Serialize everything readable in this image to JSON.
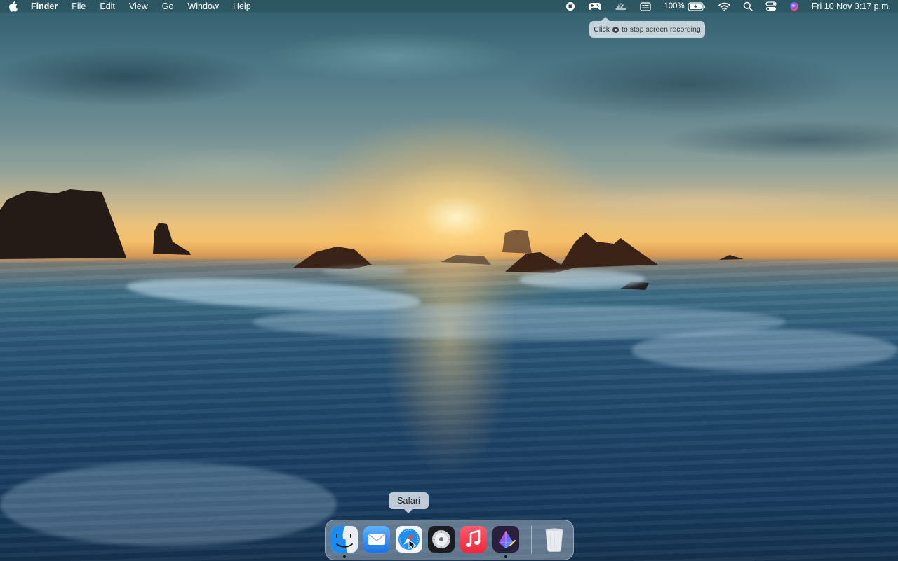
{
  "menubar": {
    "apple_menu": "apple-menu",
    "app_name": "Finder",
    "menus": [
      "File",
      "Edit",
      "View",
      "Go",
      "Window",
      "Help"
    ],
    "status": {
      "record_icon": "screen-recording-stop-icon",
      "gamepad_icon": "game-controller-icon",
      "battery_percent": "100%",
      "clock": "Fri 10 Nov  3:17 p.m."
    }
  },
  "recording_tooltip": {
    "prefix": "Click",
    "suffix": "to stop screen recording"
  },
  "dock": {
    "hover_tooltip": "Safari",
    "apps": [
      {
        "name": "Finder",
        "running": true
      },
      {
        "name": "Mail",
        "running": false
      },
      {
        "name": "Safari",
        "running": false
      },
      {
        "name": "Logic / Disk app",
        "running": false
      },
      {
        "name": "Music",
        "running": false
      },
      {
        "name": "Creative app",
        "running": true
      },
      {
        "name": "Trash",
        "running": false
      }
    ]
  },
  "colors": {
    "menubar_bg": "#2d5a66",
    "music_red": "#f23b4c",
    "safari_blue": "#1f8ef1",
    "mail_blue": "#3a8ff0"
  }
}
